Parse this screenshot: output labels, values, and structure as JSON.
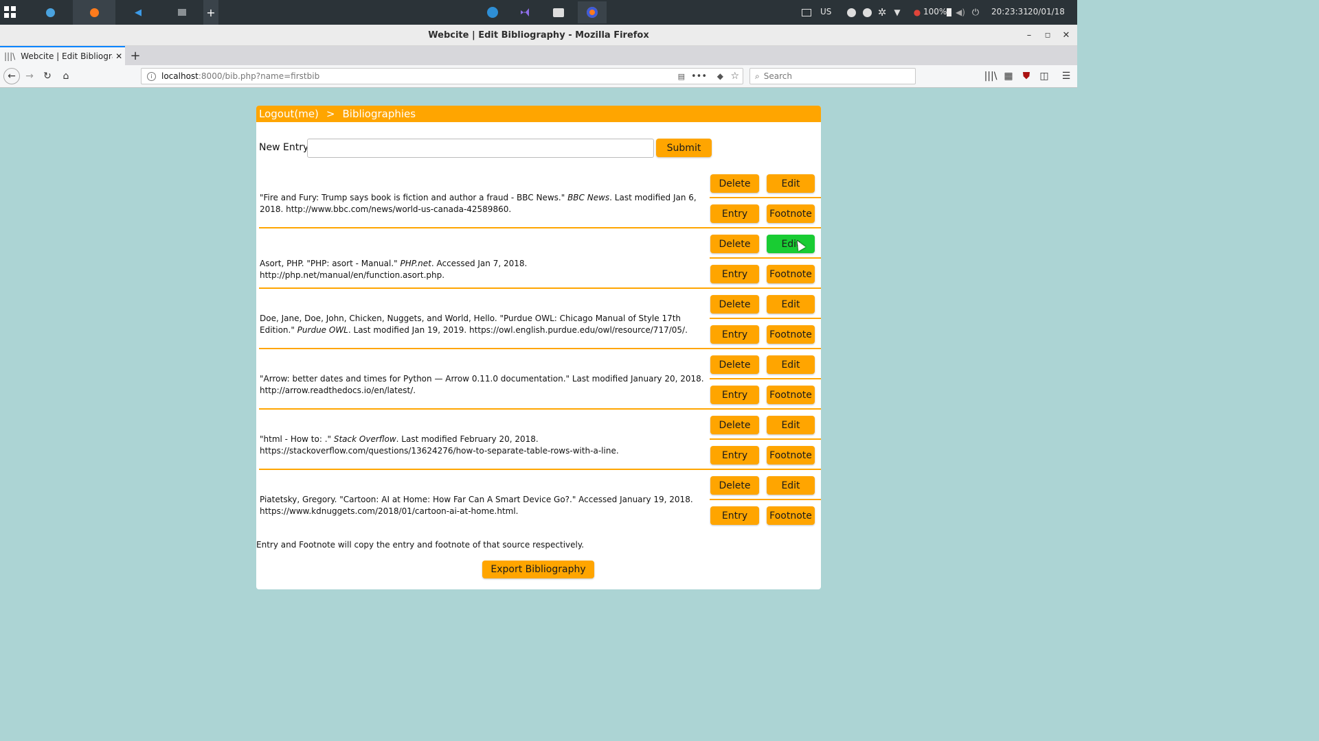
{
  "os_panel": {
    "keyboard_layout": "US",
    "battery": "100%",
    "time": "20:23:31",
    "date": "20/01/18"
  },
  "window": {
    "title": "Webcite | Edit Bibliography - Mozilla Firefox"
  },
  "browser": {
    "tab_title": "Webcite | Edit Bibliograph",
    "url_host": "localhost",
    "url_rest": ":8000/bib.php?name=firstbib",
    "search_placeholder": "Search"
  },
  "page": {
    "breadcrumb": {
      "logout": "Logout(me)",
      "separator": ">",
      "current": "Bibliographies"
    },
    "new_entry_label": "New Entry:",
    "new_entry_value": "",
    "submit_label": "Submit",
    "buttons": {
      "delete": "Delete",
      "edit": "Edit",
      "entry": "Entry",
      "footnote": "Footnote"
    },
    "entries": [
      {
        "before": "\"Fire and Fury: Trump says book is fiction and author a fraud - BBC News.\" ",
        "italic": "BBC News",
        "after": ". Last modified Jan 6, 2018. http://www.bbc.com/news/world-us-canada-42589860."
      },
      {
        "before": "Asort, PHP. \"PHP: asort - Manual.\" ",
        "italic": "PHP.net",
        "after": ". Accessed Jan 7, 2018. http://php.net/manual/en/function.asort.php."
      },
      {
        "before": "Doe, Jane, Doe, John, Chicken, Nuggets, and World, Hello. \"Purdue OWL: Chicago Manual of Style 17th Edition.\" ",
        "italic": "Purdue OWL",
        "after": ". Last modified Jan 19, 2019. https://owl.english.purdue.edu/owl/resource/717/05/."
      },
      {
        "before": "\"Arrow: better dates and times for Python — Arrow 0.11.0 documentation.\" Last modified January 20, 2018. http://arrow.readthedocs.io/en/latest/.",
        "italic": "",
        "after": ""
      },
      {
        "before": "\"html - How to: .\" ",
        "italic": "Stack Overflow",
        "after": ". Last modified February 20, 2018. https://stackoverflow.com/questions/13624276/how-to-separate-table-rows-with-a-line."
      },
      {
        "before": "Piatetsky, Gregory. \"Cartoon: AI at Home: How Far Can A Smart Device Go?.\" Accessed January 19, 2018. https://www.kdnuggets.com/2018/01/cartoon-ai-at-home.html.",
        "italic": "",
        "after": ""
      }
    ],
    "hint": "Entry and Footnote will copy the entry and footnote of that source respectively.",
    "export_label": "Export Bibliography"
  },
  "colors": {
    "accent": "#ffa500",
    "hover_green": "#19cc33",
    "background": "#acd4d4"
  }
}
